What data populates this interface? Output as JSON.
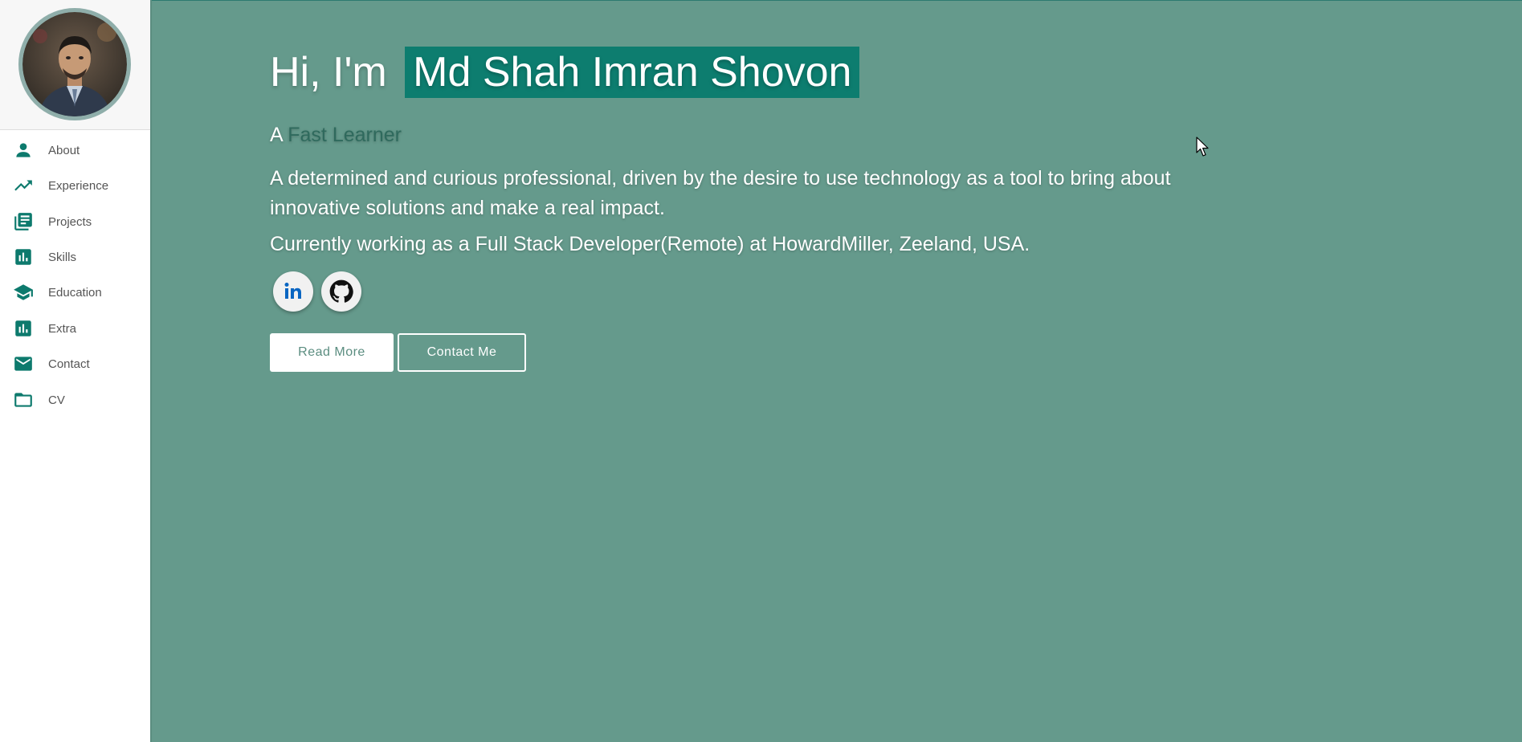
{
  "sidebar": {
    "avatar_alt": "profile photo",
    "items": [
      {
        "label": "About",
        "icon": "person-icon"
      },
      {
        "label": "Experience",
        "icon": "trending-up-icon"
      },
      {
        "label": "Projects",
        "icon": "library-books-icon"
      },
      {
        "label": "Skills",
        "icon": "bar-chart-icon"
      },
      {
        "label": "Education",
        "icon": "school-icon"
      },
      {
        "label": "Extra",
        "icon": "bar-chart-icon"
      },
      {
        "label": "Contact",
        "icon": "mail-icon"
      },
      {
        "label": "CV",
        "icon": "folder-icon"
      }
    ]
  },
  "hero": {
    "greeting_prefix": "Hi, I'm",
    "name": "Md Shah Imran Shovon",
    "tagline_prefix": "A",
    "tagline_role": "Fast Learner",
    "description": "A determined and curious professional, driven by the desire to use technology as a tool to bring about innovative solutions and make a real impact.",
    "current_position": "Currently working as a Full Stack Developer(Remote) at HowardMiller, Zeeland, USA."
  },
  "social": [
    {
      "name": "linkedin",
      "icon": "linkedin-icon"
    },
    {
      "name": "github",
      "icon": "github-icon"
    }
  ],
  "actions": {
    "read_more": "Read More",
    "contact_me": "Contact Me"
  },
  "colors": {
    "background": "#659a8c",
    "accent": "#0d7d6f",
    "sidebar_icon": "#0d7a6d"
  }
}
